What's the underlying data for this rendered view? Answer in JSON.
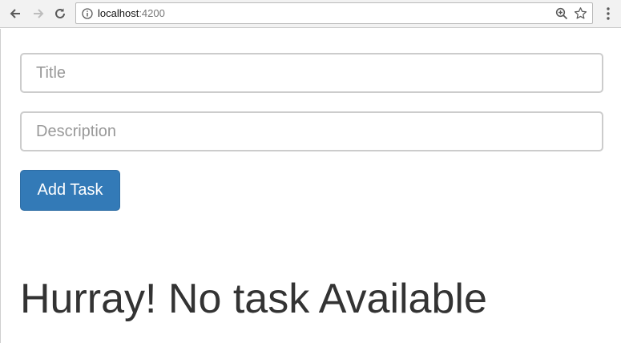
{
  "browser": {
    "url_host": "localhost",
    "url_port": ":4200",
    "icons": {
      "back": "back-arrow-icon",
      "forward": "forward-arrow-icon",
      "reload": "reload-icon",
      "info": "info-icon",
      "zoom": "zoom-icon",
      "bookmark": "star-icon",
      "menu": "kebab-menu-icon"
    }
  },
  "form": {
    "title_placeholder": "Title",
    "title_value": "",
    "description_placeholder": "Description",
    "description_value": "",
    "add_button_label": "Add Task"
  },
  "status": {
    "empty_message": "Hurray! No task Available"
  },
  "colors": {
    "primary_button": "#337ab7",
    "text": "#333333"
  }
}
